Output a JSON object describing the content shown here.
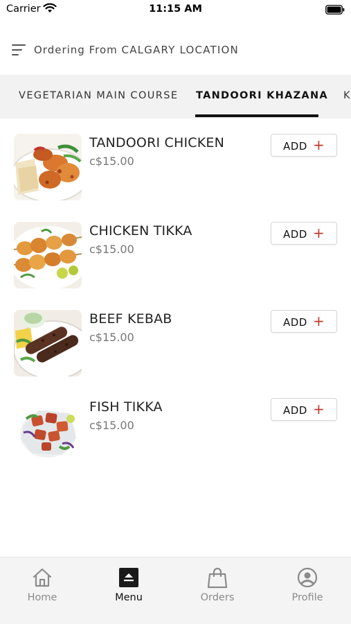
{
  "status_bar": {
    "carrier": "Carrier",
    "time": "11:15 AM"
  },
  "header": {
    "prefix": "Ordering From",
    "location": "CALGARY LOCATION",
    "menu_icon": "filter-lines-icon"
  },
  "tabs": [
    {
      "label": "VEGETARIAN MAIN COURSE",
      "active": false
    },
    {
      "label": "TANDOORI KHAZANA",
      "active": true
    },
    {
      "label": "K",
      "active": false
    }
  ],
  "items": [
    {
      "name": "TANDOORI CHICKEN",
      "price": "c$15.00",
      "add_label": "ADD",
      "add_icon": "+"
    },
    {
      "name": "CHICKEN TIKKA",
      "price": "c$15.00",
      "add_label": "ADD",
      "add_icon": "+"
    },
    {
      "name": "BEEF KEBAB",
      "price": "c$15.00",
      "add_label": "ADD",
      "add_icon": "+"
    },
    {
      "name": "FISH TIKKA",
      "price": "c$15.00",
      "add_label": "ADD",
      "add_icon": "+"
    }
  ],
  "bottom_nav": [
    {
      "label": "Home",
      "icon": "home-icon",
      "active": false
    },
    {
      "label": "Menu",
      "icon": "menu-icon",
      "active": true
    },
    {
      "label": "Orders",
      "icon": "bag-icon",
      "active": false
    },
    {
      "label": "Profile",
      "icon": "profile-icon",
      "active": false
    }
  ],
  "colors": {
    "accent_plus": "#c0392b",
    "tab_bar_bg": "#f2f2f2",
    "active_text": "#111111",
    "inactive_text": "#8a8a8a"
  }
}
